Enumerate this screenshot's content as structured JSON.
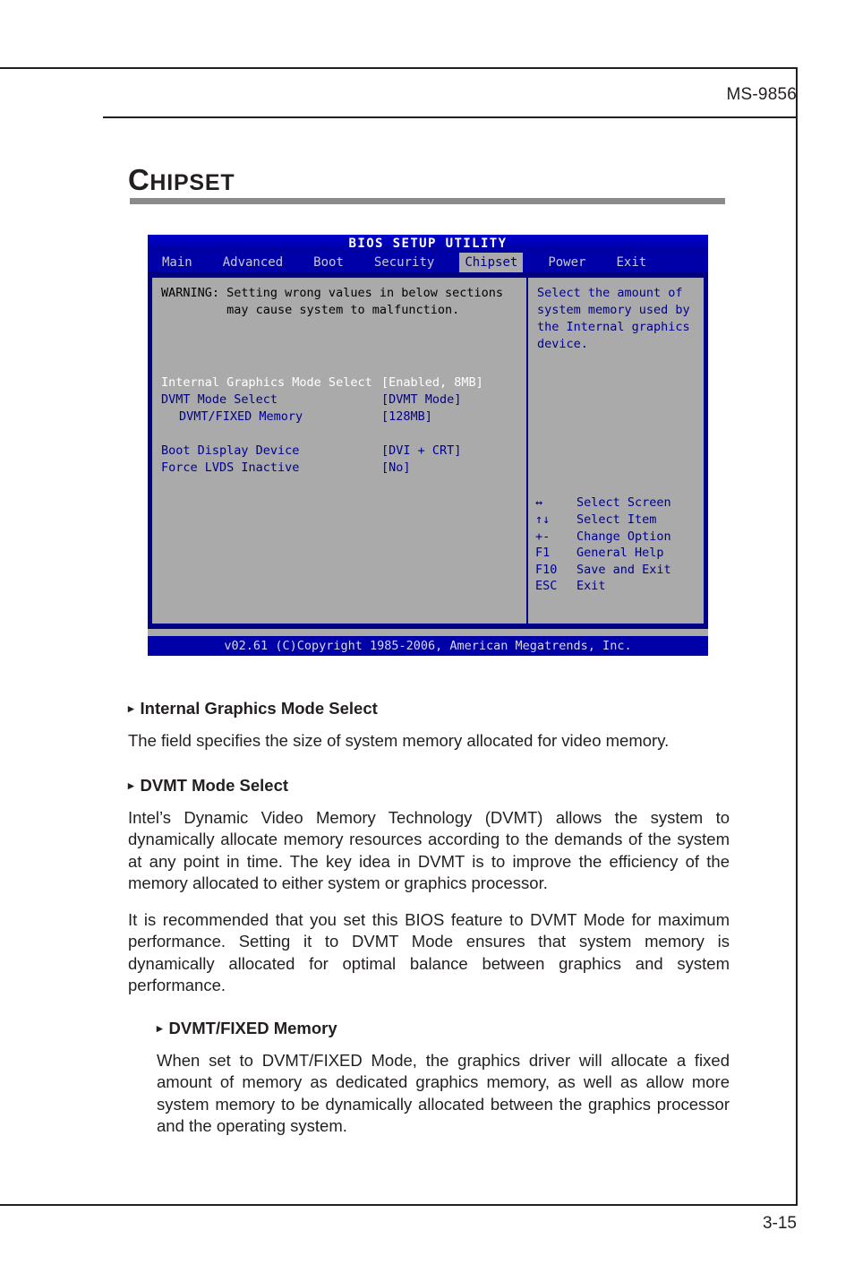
{
  "page": {
    "model_number": "MS-9856",
    "page_number": "3-15",
    "chapter_title_cap": "C",
    "chapter_title_rest": "HIPSET"
  },
  "bios": {
    "title": "BIOS SETUP UTILITY",
    "tabs": [
      {
        "label": "Main",
        "active": false
      },
      {
        "label": "Advanced",
        "active": false
      },
      {
        "label": "Boot",
        "active": false
      },
      {
        "label": "Security",
        "active": false
      },
      {
        "label": "Chipset",
        "active": true
      },
      {
        "label": "Power",
        "active": false
      },
      {
        "label": "Exit",
        "active": false
      }
    ],
    "warning_line1": "WARNING: Setting wrong values in below sections",
    "warning_line2": "         may cause system to malfunction.",
    "settings": [
      {
        "label": "Internal Graphics Mode Select",
        "value": "[Enabled, 8MB]",
        "selected": true,
        "indent": false
      },
      {
        "label": "DVMT Mode Select",
        "value": "[DVMT Mode]",
        "selected": false,
        "indent": false
      },
      {
        "label": "DVMT/FIXED Memory",
        "value": "[128MB]",
        "selected": false,
        "indent": true
      },
      {
        "label": "Boot Display Device",
        "value": "[DVI + CRT]",
        "selected": false,
        "indent": false
      },
      {
        "label": "Force LVDS Inactive",
        "value": "[No]",
        "selected": false,
        "indent": false
      }
    ],
    "help_text": "Select the amount of\nsystem memory used by\nthe Internal graphics\ndevice.",
    "legend": [
      {
        "key": "↔",
        "desc": "Select Screen"
      },
      {
        "key": "↑↓",
        "desc": "Select Item"
      },
      {
        "key": "+-",
        "desc": "Change Option"
      },
      {
        "key": "F1",
        "desc": "General Help"
      },
      {
        "key": "F10",
        "desc": "Save and Exit"
      },
      {
        "key": "ESC",
        "desc": "Exit"
      }
    ],
    "statusbar": "v02.61 (C)Copyright 1985-2006, American Megatrends, Inc.",
    "colors": {
      "window_blue": "#0000a8",
      "panel_gray": "#aaaaaa",
      "text_blue": "#00008b",
      "selected_text": "#ffffff"
    }
  },
  "doc": {
    "bullet": "▸",
    "section1": {
      "heading": "Internal Graphics Mode Select",
      "paragraph": "The field specifies the size of system memory allocated for video memory."
    },
    "section2": {
      "heading": "DVMT Mode Select",
      "paragraph1": "Intel’s Dynamic Video Memory Technology (DVMT) allows the system to dynamically allocate memory resources according to the demands of the system at any point in time. The key idea in DVMT is to improve the efficiency of the memory allocated to either system or graphics processor.",
      "paragraph2": "It is recommended that you set this BIOS feature to DVMT Mode for maximum performance. Setting it to DVMT Mode ensures that system memory is dynamically allocated for optimal balance between graphics and system performance."
    },
    "section3": {
      "heading": "DVMT/FIXED Memory",
      "paragraph": "When set to DVMT/FIXED Mode, the graphics driver will allocate a fixed amount of memory as dedicated graphics memory, as well as allow more system memory to be dynamically allocated between the graphics processor and the operating system."
    }
  }
}
